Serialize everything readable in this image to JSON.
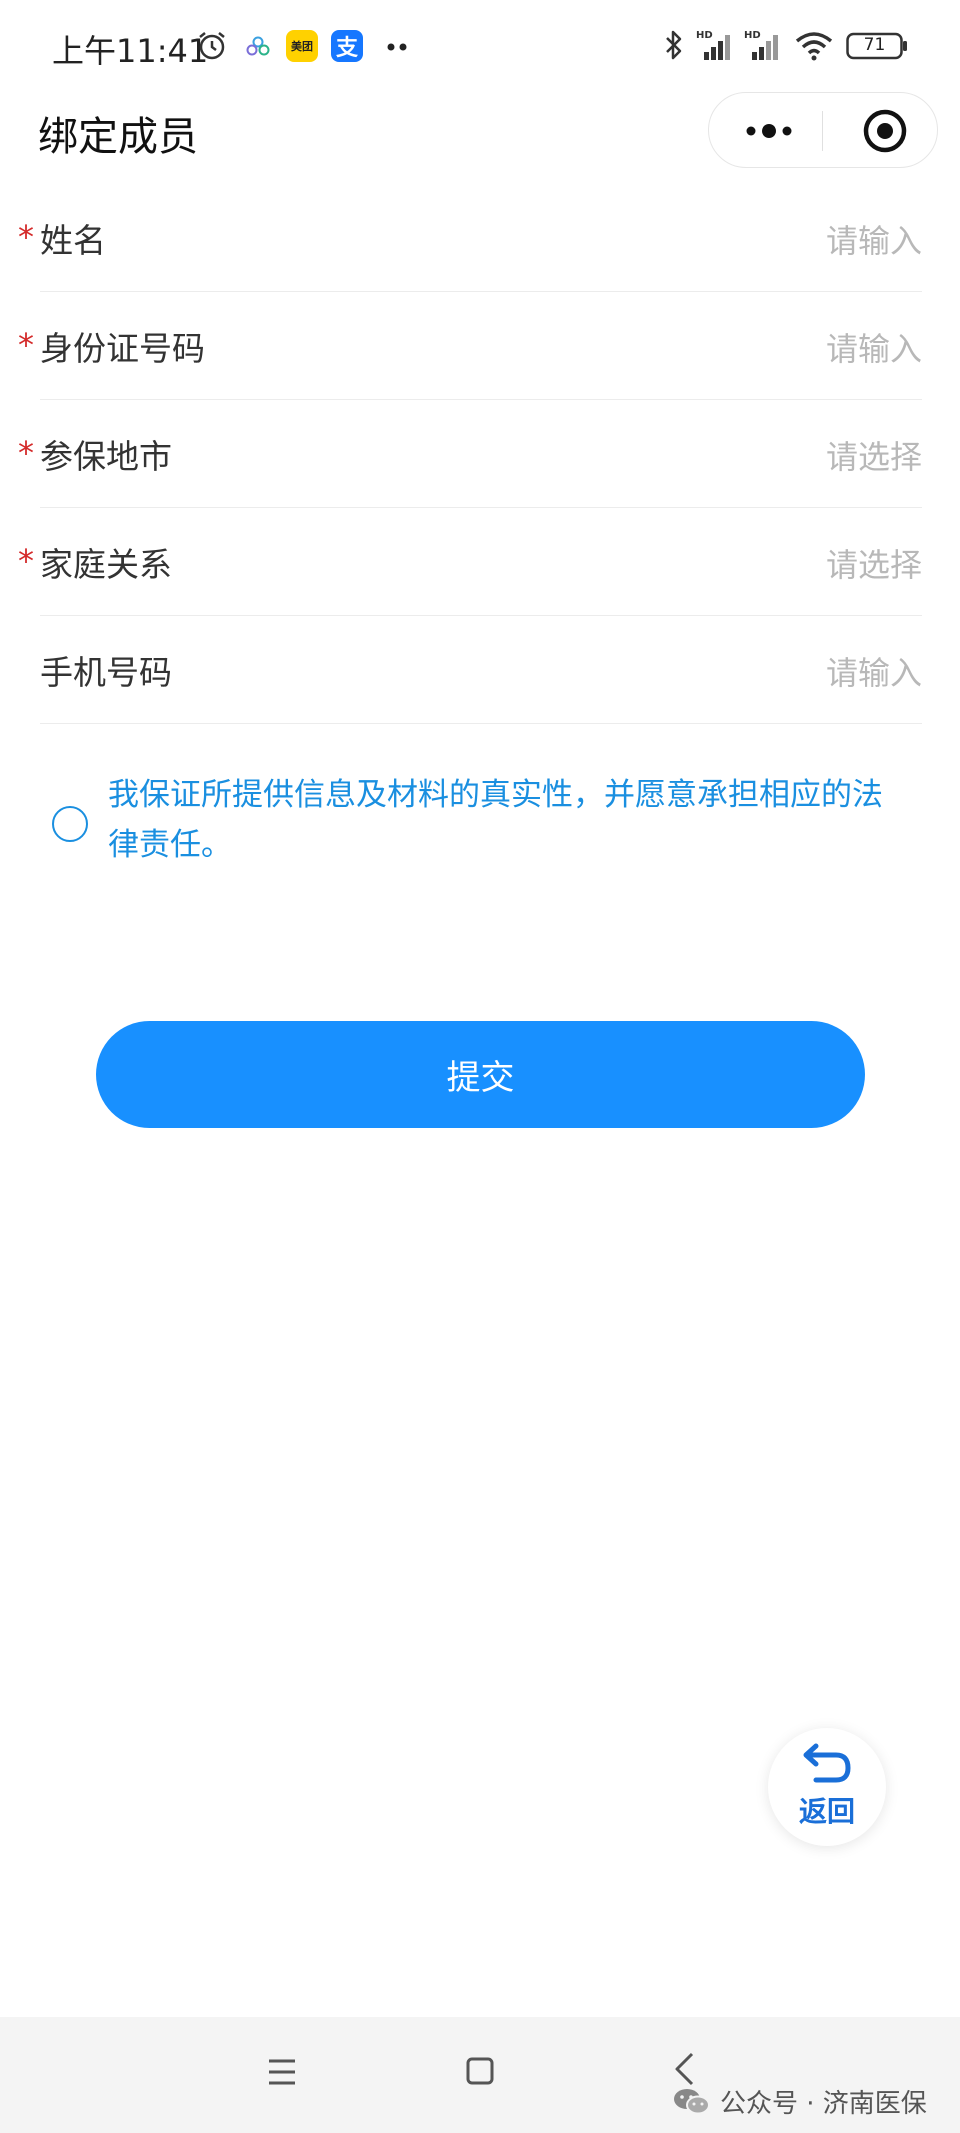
{
  "status_bar": {
    "time": "上午11:41",
    "meituan_label": "美团",
    "alipay_label": "支",
    "battery": "71"
  },
  "header": {
    "title": "绑定成员"
  },
  "form": {
    "fields": [
      {
        "label": "姓名",
        "placeholder": "请输入",
        "required": true
      },
      {
        "label": "身份证号码",
        "placeholder": "请输入",
        "required": true
      },
      {
        "label": "参保地市",
        "placeholder": "请选择",
        "required": true
      },
      {
        "label": "家庭关系",
        "placeholder": "请选择",
        "required": true
      },
      {
        "label": "手机号码",
        "placeholder": "请输入",
        "required": false
      }
    ],
    "required_mark": "*"
  },
  "agreement": {
    "text": "我保证所提供信息及材料的真实性，并愿意承担相应的法律责任。"
  },
  "submit": {
    "label": "提交"
  },
  "return_button": {
    "label": "返回"
  },
  "watermark": {
    "text": "公众号 · 济南医保"
  },
  "colors": {
    "accent": "#1890ff",
    "link": "#1a8fe0",
    "required": "#d42a2a",
    "placeholder": "#b8b8b8"
  }
}
